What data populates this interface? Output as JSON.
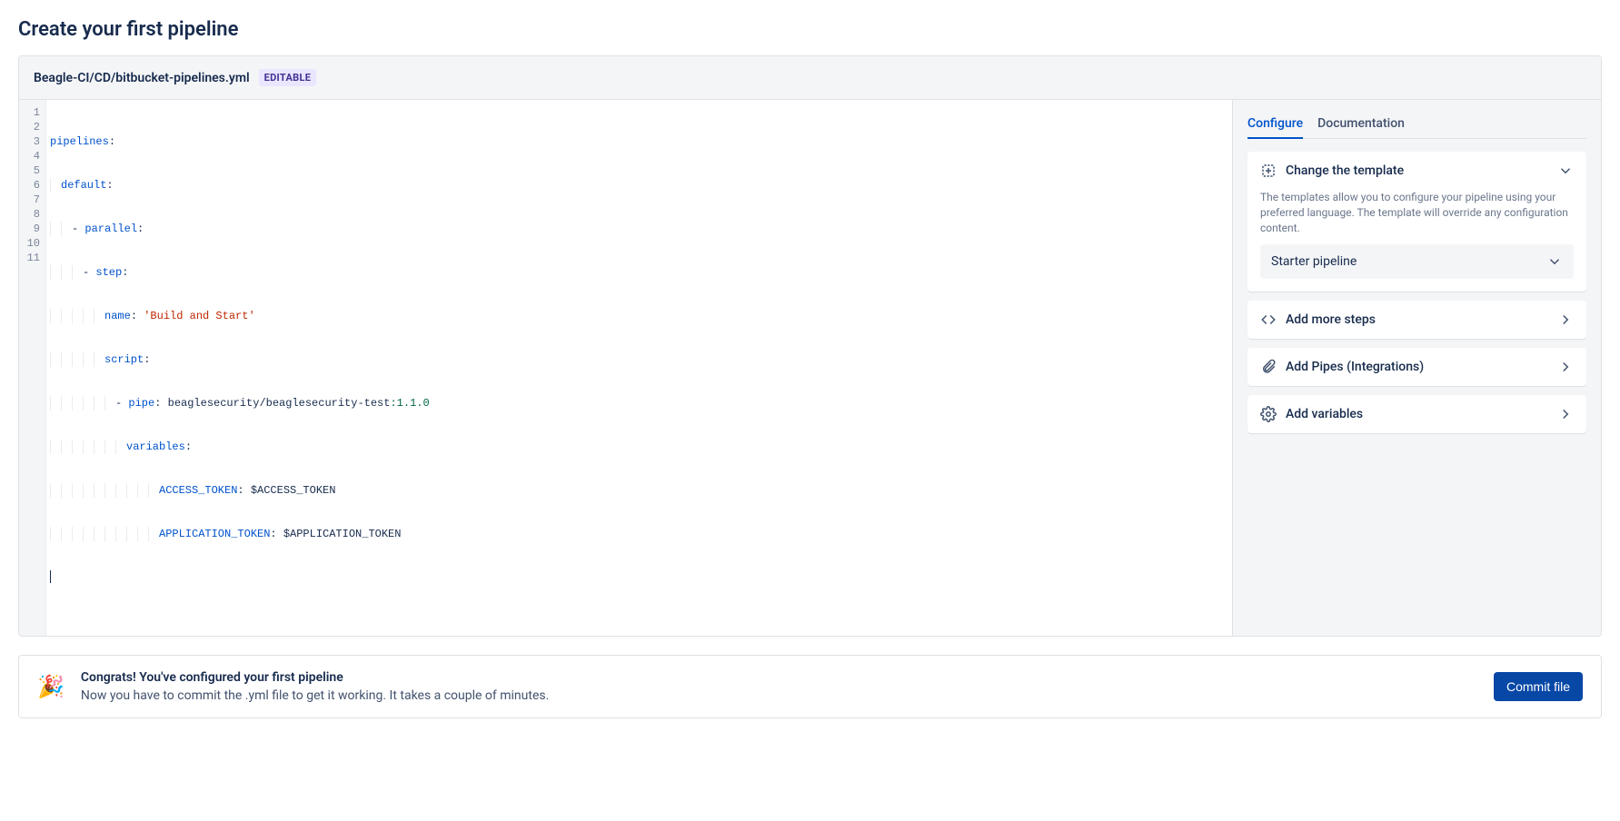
{
  "page": {
    "title": "Create your first pipeline"
  },
  "header": {
    "file_path": "Beagle-CI/CD/bitbucket-pipelines.yml",
    "badge": "EDITABLE"
  },
  "editor": {
    "line_numbers": [
      "1",
      "2",
      "3",
      "4",
      "5",
      "6",
      "7",
      "8",
      "9",
      "10",
      "11"
    ],
    "tokens": {
      "pipelines": "pipelines",
      "default": "default",
      "parallel": "parallel",
      "step": "step",
      "name": "name",
      "name_value": "'Build and Start'",
      "script": "script",
      "pipe": "pipe",
      "pipe_value": " beaglesecurity/beaglesecurity-test",
      "pipe_version": ":1.1.0",
      "variables": "variables",
      "access_token": "ACCESS_TOKEN",
      "access_token_value": " $ACCESS_TOKEN",
      "application_token": "APPLICATION_TOKEN",
      "application_token_value": " $APPLICATION_TOKEN",
      "colon": ":",
      "dash": "- "
    }
  },
  "sidebar": {
    "tabs": {
      "configure": "Configure",
      "documentation": "Documentation"
    },
    "change_template": {
      "label": "Change the template",
      "description": "The templates allow you to configure your pipeline using your preferred language. The template will override any configuration content.",
      "selected": "Starter pipeline"
    },
    "add_steps": {
      "label": "Add more steps"
    },
    "add_pipes": {
      "label": "Add Pipes (Integrations)"
    },
    "add_variables": {
      "label": "Add variables"
    }
  },
  "congrats": {
    "title": "Congrats! You've configured your first pipeline",
    "description": "Now you have to commit the .yml file to get it working. It takes a couple of minutes.",
    "button": "Commit file"
  }
}
